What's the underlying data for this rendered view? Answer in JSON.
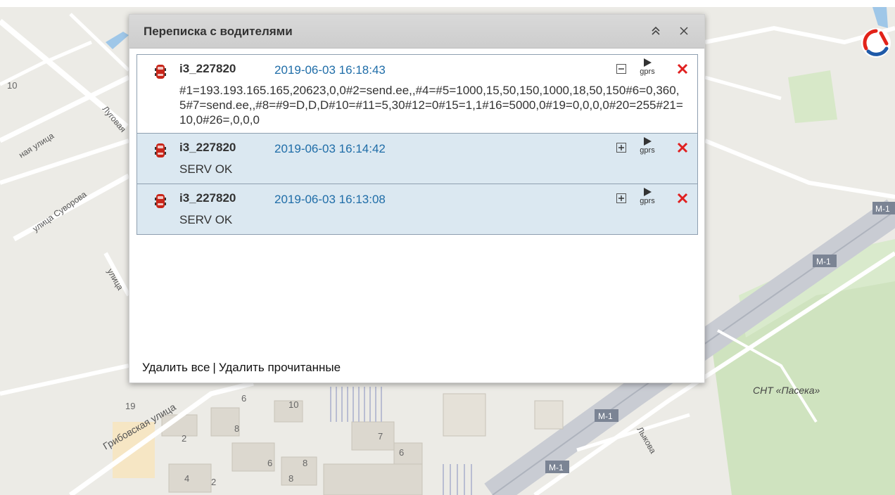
{
  "dialog": {
    "title": "Переписка с водителями",
    "collapse_icon": "chevron-double-up-icon",
    "close_icon": "close-icon"
  },
  "messages": [
    {
      "sender": "i3_227820",
      "time": "2019-06-03 16:18:43",
      "text": "#1=193.193.165.165,20623,0,0#2=send.ee,,#4=#5=1000,15,50,150,1000,18,50,150#6=0,360,5#7=send.ee,,#8=#9=D,D,D#10=#11=5,30#12=0#15=1,1#16=5000,0#19=0,0,0,0#20=255#21=10,0#26=,0,0,0",
      "state": "expanded",
      "gprs_label": "gprs"
    },
    {
      "sender": "i3_227820",
      "time": "2019-06-03 16:14:42",
      "text": "SERV OK",
      "state": "collapsed",
      "gprs_label": "gprs"
    },
    {
      "sender": "i3_227820",
      "time": "2019-06-03 16:13:08",
      "text": "SERV OK",
      "state": "collapsed",
      "gprs_label": "gprs"
    }
  ],
  "footer": {
    "delete_all": "Удалить все",
    "separator": "|",
    "delete_read": "Удалить прочитанные"
  },
  "map": {
    "labels": {
      "street_suvorova": "улица Суворова",
      "street_lugovaya": "Луговая",
      "street_partial_1": "ная улица",
      "street_partial_2": "улица",
      "street_gribovskaya": "Грибовская улица",
      "street_lykova": "Лыкова",
      "snt": "СНТ «Пасека»",
      "m1_a": "М-1",
      "m1_b": "М-1",
      "m1_c": "М-1",
      "m1_d": "М-1"
    },
    "house_numbers": [
      "10",
      "19",
      "6",
      "10",
      "8",
      "2",
      "7",
      "6",
      "6",
      "8",
      "4",
      "2",
      "8"
    ]
  },
  "colors": {
    "time": "#1f6da8",
    "delete": "#e02020",
    "collapsed_bg": "#dbe8f1",
    "header_bg": "#d0d0d0"
  }
}
